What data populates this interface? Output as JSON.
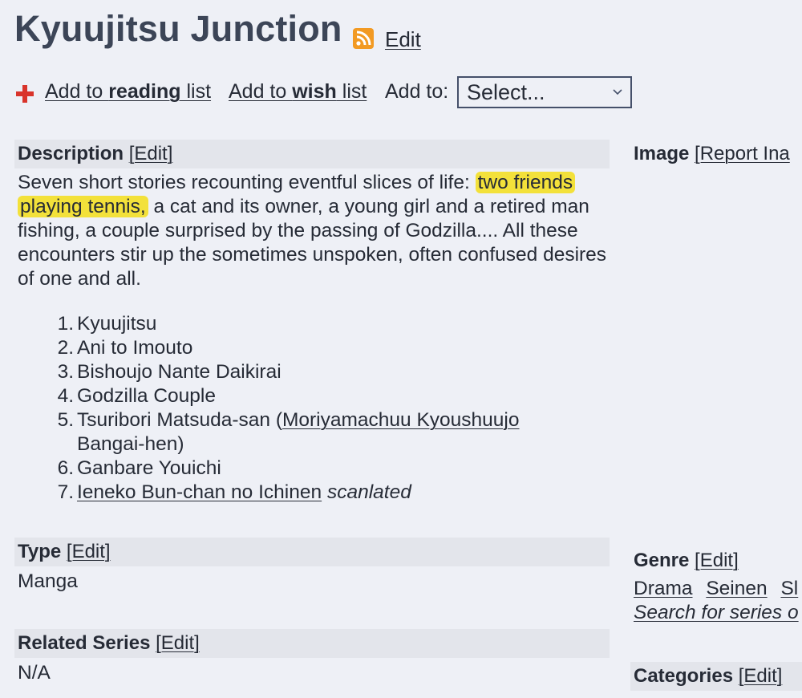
{
  "header": {
    "title": "Kyuujitsu Junction",
    "edit_label": "Edit"
  },
  "actions": {
    "reading_prefix": "Add to ",
    "reading_bold": "reading",
    "reading_suffix": " list",
    "wish_prefix": "Add to ",
    "wish_bold": "wish",
    "wish_suffix": " list",
    "add_to_label": "Add to:",
    "select_value": "Select..."
  },
  "description": {
    "heading": "Description",
    "edit_label": "[Edit]",
    "text_before": "Seven short stories recounting eventful slices of life:",
    "highlighted": "two friends playing tennis,",
    "text_after": " a cat and its owner, a young girl and a retired man fishing, a couple surprised by the passing of Godzilla.... All these encounters stir up the sometimes unspoken, often confused desires of one and all.",
    "stories": [
      {
        "num": "1.",
        "text": "Kyuujitsu"
      },
      {
        "num": "2.",
        "text": "Ani to Imouto"
      },
      {
        "num": "3.",
        "text": "Bishoujo Nante Daikirai"
      },
      {
        "num": "4.",
        "text": "Godzilla Couple"
      },
      {
        "num": "5.",
        "text": "Tsuribori Matsuda-san (",
        "link": "Moriyamachuu Kyoushuujo",
        "text2": " Bangai-hen)"
      },
      {
        "num": "6.",
        "text": "Ganbare Youichi"
      },
      {
        "num": "7.",
        "link": "Ieneko Bun-chan no Ichinen",
        "note": "scanlated"
      }
    ]
  },
  "image_section": {
    "heading": "Image",
    "report_label": "[Report Ina"
  },
  "type_section": {
    "heading": "Type",
    "edit_label": "[Edit]",
    "value": "Manga"
  },
  "related_section": {
    "heading": "Related Series",
    "edit_label": "[Edit]",
    "value": "N/A"
  },
  "genre_section": {
    "heading": "Genre",
    "edit_label": "[Edit]",
    "genres": [
      "Drama",
      "Seinen",
      "Sl"
    ],
    "search_label": "Search for series o"
  },
  "categories_section": {
    "heading": "Categories",
    "edit_label": "[Edit]"
  },
  "colors": {
    "background": "#eef0f6",
    "section_band": "#e3e5eb",
    "highlight": "#f3e13a",
    "rss": "#f29a23",
    "plus_icon": "#d9342b"
  },
  "icons": {
    "rss": "rss-icon",
    "add": "plus-icon",
    "select_arrow": "chevron-down-icon"
  }
}
